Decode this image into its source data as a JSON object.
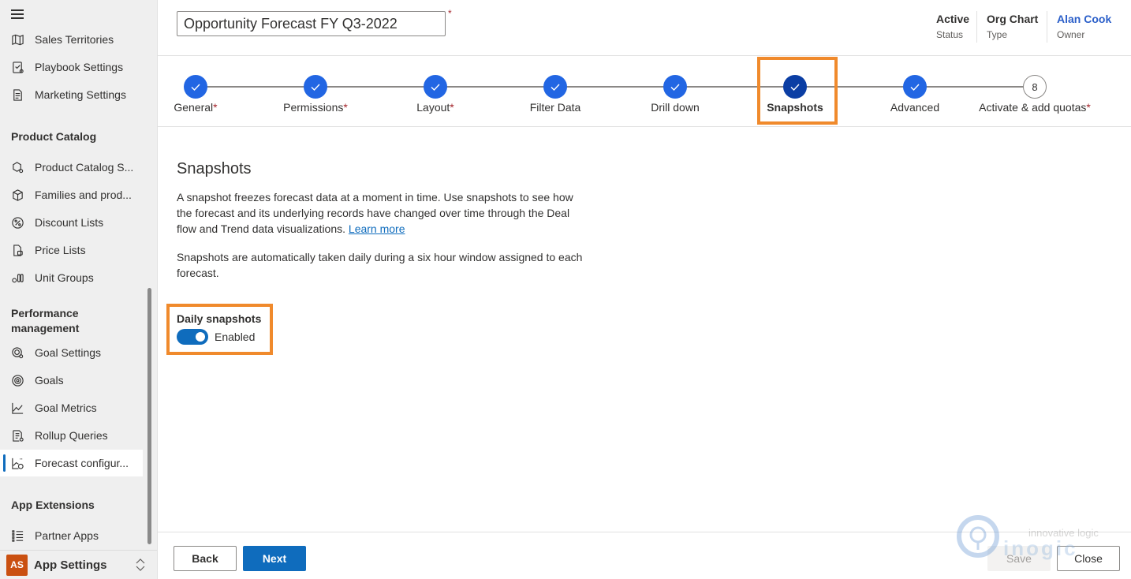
{
  "sidebar": {
    "menu_icon": "hamburger-icon",
    "top_items": [
      {
        "label": "Sales Territories",
        "icon": "map-icon"
      },
      {
        "label": "Playbook Settings",
        "icon": "playbook-icon"
      },
      {
        "label": "Marketing Settings",
        "icon": "marketing-icon"
      }
    ],
    "groups": [
      {
        "title": "Product Catalog",
        "items": [
          {
            "label": "Product Catalog S...",
            "icon": "product-settings-icon"
          },
          {
            "label": "Families and prod...",
            "icon": "box-icon"
          },
          {
            "label": "Discount Lists",
            "icon": "percent-icon"
          },
          {
            "label": "Price Lists",
            "icon": "price-list-icon"
          },
          {
            "label": "Unit Groups",
            "icon": "unit-groups-icon"
          }
        ]
      },
      {
        "title": "Performance management",
        "items": [
          {
            "label": "Goal Settings",
            "icon": "goal-settings-icon"
          },
          {
            "label": "Goals",
            "icon": "target-icon"
          },
          {
            "label": "Goal Metrics",
            "icon": "line-chart-icon"
          },
          {
            "label": "Rollup Queries",
            "icon": "rollup-query-icon"
          },
          {
            "label": "Forecast configur...",
            "icon": "forecast-icon",
            "active": true
          }
        ]
      },
      {
        "title": "App Extensions",
        "items": [
          {
            "label": "Partner Apps",
            "icon": "list-icon"
          }
        ]
      }
    ],
    "app_switcher": {
      "initials": "AS",
      "label": "App Settings",
      "badge_color": "#ca5010"
    }
  },
  "header": {
    "title_value": "Opportunity Forecast FY Q3-2022",
    "required_marker": "*",
    "fields": [
      {
        "value": "Active",
        "label": "Status"
      },
      {
        "value": "Org Chart",
        "label": "Type"
      },
      {
        "value": "Alan Cook",
        "label": "Owner"
      }
    ]
  },
  "stepper": {
    "steps": [
      {
        "label": "General",
        "required": "*",
        "state": "complete"
      },
      {
        "label": "Permissions",
        "required": "*",
        "state": "complete"
      },
      {
        "label": "Layout",
        "required": "*",
        "state": "complete"
      },
      {
        "label": "Filter Data",
        "required": "",
        "state": "complete"
      },
      {
        "label": "Drill down",
        "required": "",
        "state": "complete"
      },
      {
        "label": "Snapshots",
        "required": "",
        "state": "current"
      },
      {
        "label": "Advanced",
        "required": "",
        "state": "complete"
      },
      {
        "label": "Activate & add quotas",
        "required": "*",
        "state": "pending",
        "number": "8"
      }
    ]
  },
  "content": {
    "title": "Snapshots",
    "description": "A snapshot freezes forecast data at a moment in time. Use snapshots to see how the forecast and its underlying records have changed over time through the Deal flow and Trend data visualizations.",
    "learn_more": "Learn more",
    "description2": "Snapshots are automatically taken daily during a six hour window assigned to each forecast.",
    "toggle": {
      "label": "Daily snapshots",
      "state_text": "Enabled",
      "on": true
    }
  },
  "footer": {
    "back": "Back",
    "next": "Next",
    "save": "Save",
    "close": "Close"
  },
  "watermark": {
    "tagline": "innovative logic",
    "brand": "inogic"
  },
  "colors": {
    "accent": "#0f6cbd",
    "step_complete": "#2266e3",
    "step_current": "#0b3ea4",
    "highlight": "#f08a2c",
    "owner_link": "#2b5fc9"
  }
}
